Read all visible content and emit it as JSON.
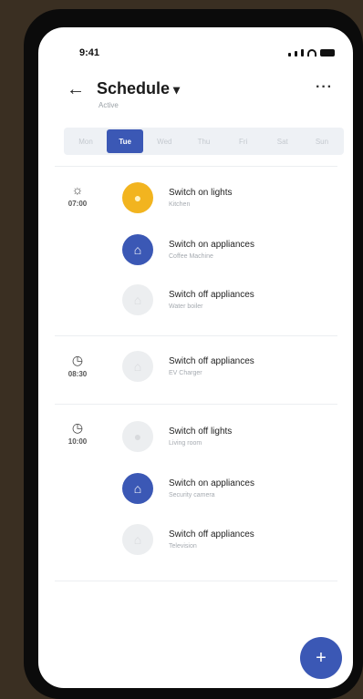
{
  "status_bar": {
    "time": "9:41"
  },
  "header": {
    "title": "Schedule",
    "subtitle": "Active"
  },
  "day_tabs": [
    {
      "label": "Mon",
      "active": false
    },
    {
      "label": "Tue",
      "active": true
    },
    {
      "label": "Wed",
      "active": false
    },
    {
      "label": "Thu",
      "active": false
    },
    {
      "label": "Fri",
      "active": false
    },
    {
      "label": "Sat",
      "active": false
    },
    {
      "label": "Sun",
      "active": false
    }
  ],
  "groups": [
    {
      "time": "07:00",
      "time_icon": "sunrise-icon",
      "events": [
        {
          "title": "Switch on lights",
          "subtitle": "Kitchen",
          "icon": "lightbulb-icon",
          "color": "#f2b41f"
        },
        {
          "title": "Switch on appliances",
          "subtitle": "Coffee Machine",
          "icon": "plug-icon",
          "color": "#3b58b5"
        },
        {
          "title": "Switch off appliances",
          "subtitle": "Water boiler",
          "icon": "plug-icon",
          "color": "#eceef0"
        }
      ]
    },
    {
      "time": "08:30",
      "time_icon": "clock-icon",
      "events": [
        {
          "title": "Switch off appliances",
          "subtitle": "EV Charger",
          "icon": "plug-icon",
          "color": "#eceef0"
        }
      ]
    },
    {
      "time": "10:00",
      "time_icon": "clock-icon",
      "events": [
        {
          "title": "Switch off lights",
          "subtitle": "Living room",
          "icon": "lightbulb-icon",
          "color": "#eceef0"
        },
        {
          "title": "Switch on appliances",
          "subtitle": "Security camera",
          "icon": "plug-icon",
          "color": "#3b58b5"
        },
        {
          "title": "Switch off appliances",
          "subtitle": "Television",
          "icon": "plug-icon",
          "color": "#eceef0"
        }
      ]
    }
  ],
  "fab": {
    "label": "+"
  },
  "colors": {
    "accent": "#3b58b5",
    "yellow": "#f2b41f",
    "inactive": "#eceef0"
  }
}
